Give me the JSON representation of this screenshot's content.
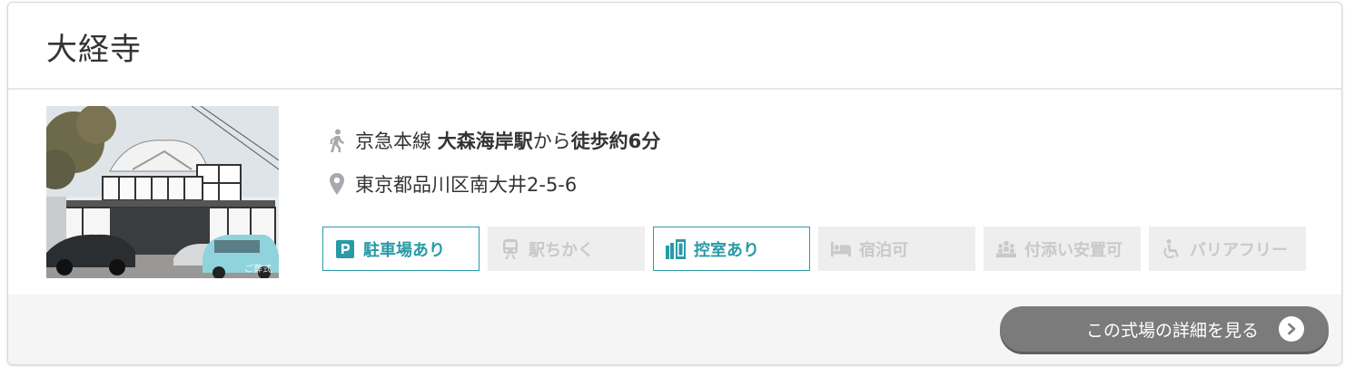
{
  "venue": {
    "title": "大経寺",
    "photo_watermark": "ご葬式"
  },
  "access": {
    "line": "京急本線",
    "station": "大森海岸駅",
    "from": "から",
    "walk": "徒歩約6分"
  },
  "address": "東京都品川区南大井2-5-6",
  "features": [
    {
      "label": "駐車場あり",
      "icon": "parking-icon",
      "active": true
    },
    {
      "label": "駅ちかく",
      "icon": "train-icon",
      "active": false
    },
    {
      "label": "控室あり",
      "icon": "waiting-room-icon",
      "active": true
    },
    {
      "label": "宿泊可",
      "icon": "bed-icon",
      "active": false
    },
    {
      "label": "付添い安置可",
      "icon": "attendants-icon",
      "active": false
    },
    {
      "label": "バリアフリー",
      "icon": "wheelchair-icon",
      "active": false
    }
  ],
  "footer": {
    "detail_button": "この式場の詳細を見る"
  },
  "colors": {
    "accent": "#2a9aa6",
    "inactive_bg": "#eeeeee",
    "inactive_text": "#c9c9c9",
    "button_bg": "#7b7b7b"
  }
}
